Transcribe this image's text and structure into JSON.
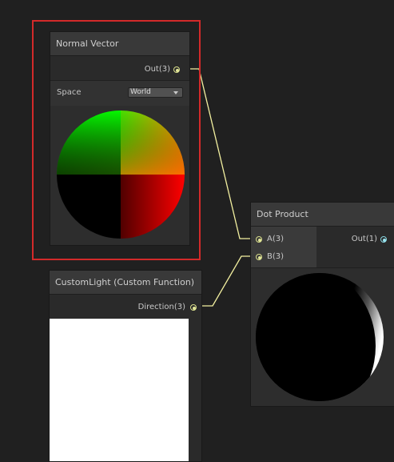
{
  "colors": {
    "background": "#202020",
    "node_body": "#2a2a2a",
    "node_header": "#393939",
    "vector3_port": "#e3e79a",
    "float_port": "#9be5ef",
    "selection_outline": "#d32a2a",
    "wire": "#f3f0a0"
  },
  "nodes": {
    "normal_vector": {
      "title": "Normal Vector",
      "output_port": "Out(3)",
      "space_label": "Space",
      "space_value": "World",
      "selected": true
    },
    "dot_product": {
      "title": "Dot Product",
      "input_a": "A(3)",
      "input_b": "B(3)",
      "output_port": "Out(1)"
    },
    "custom_light": {
      "title": "CustomLight (Custom Function)",
      "output_port": "Direction(3)"
    }
  },
  "icons": [
    "port-icon",
    "dropdown-caret-icon"
  ]
}
